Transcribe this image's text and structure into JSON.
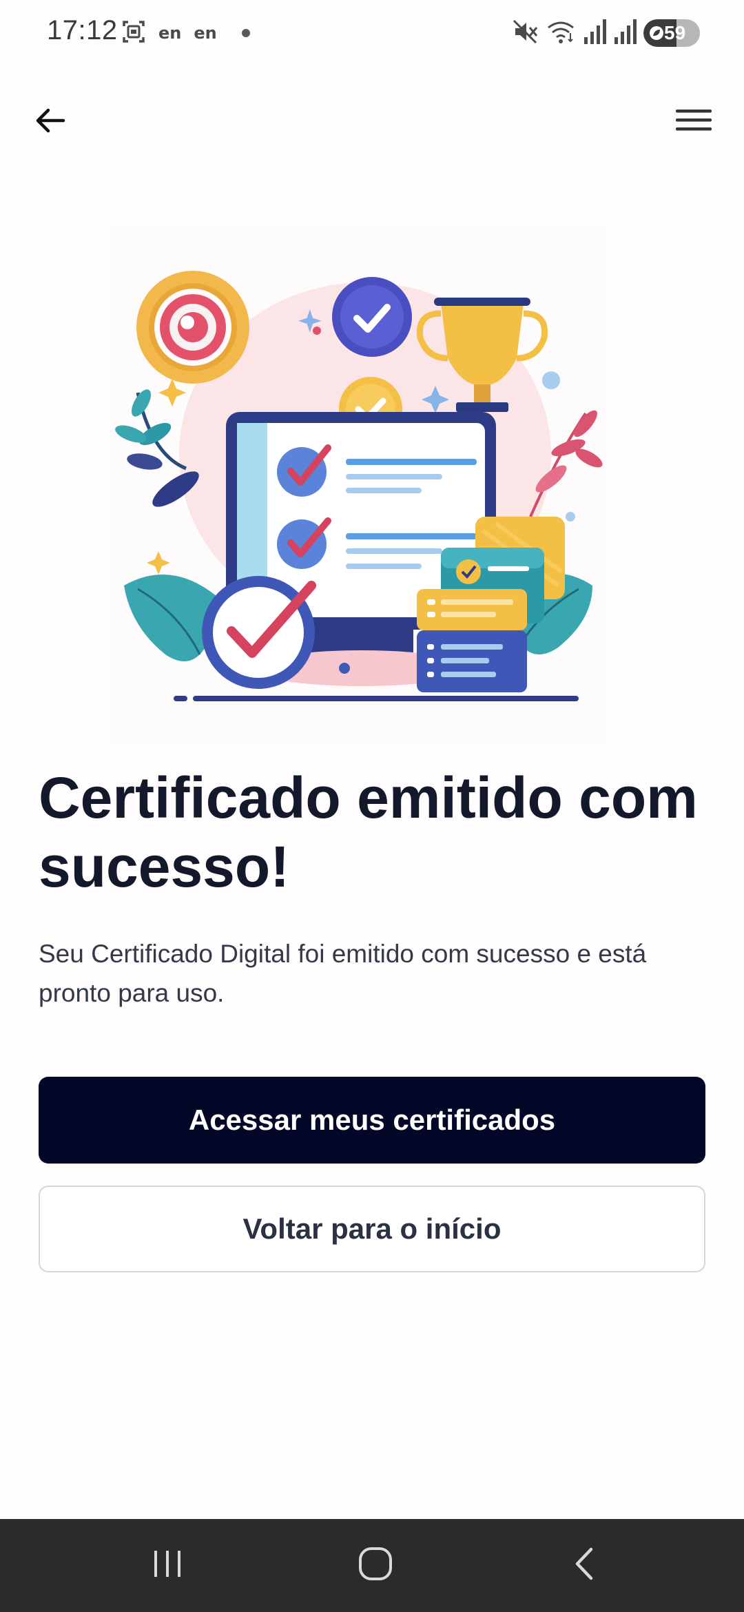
{
  "status_bar": {
    "time": "17:12",
    "lang_1": "en",
    "lang_2": "en",
    "battery_level": "59",
    "battery_fraction": 0.59,
    "icons": [
      "screenshot-icon",
      "mute-icon",
      "wifi-icon",
      "signal-icon",
      "signal-icon",
      "battery-icon"
    ]
  },
  "app_bar": {
    "back_icon": "arrow-left-icon",
    "menu_icon": "hamburger-menu-icon"
  },
  "main": {
    "title": "Certificado emitido com sucesso!",
    "subtitle": "Seu Certificado Digital foi emitido com sucesso e está pronto para uso.",
    "primary_button": "Acessar meus certificados",
    "secondary_button": "Voltar para o início"
  },
  "nav_bar": {
    "icons": [
      "recent-apps-icon",
      "home-icon",
      "back-icon"
    ]
  },
  "colors": {
    "primary_button_bg": "#040828",
    "title_text": "#13192b",
    "nav_bar_bg": "#2b2b2b"
  }
}
